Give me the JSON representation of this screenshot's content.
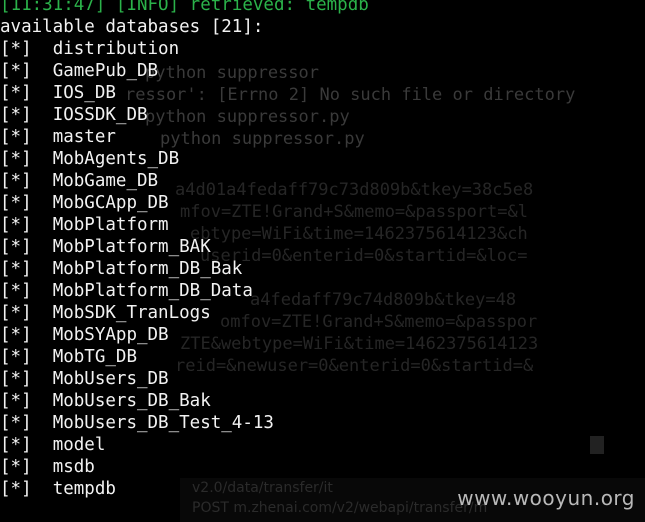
{
  "terminal": {
    "header": {
      "timestamp": "[11:31:47]",
      "level": "[INFO]",
      "message": "retrieved: tempdb"
    },
    "title": "available databases [21]:",
    "marker": "[*]",
    "databases": [
      "distribution",
      "GamePub_DB",
      "IOS_DB",
      "IOSSDK_DB",
      "master",
      "MobAgents_DB",
      "MobGame_DB",
      "MobGCApp_DB",
      "MobPlatform",
      "MobPlatform_BAK",
      "MobPlatform_DB_Bak",
      "MobPlatform_DB_Data",
      "MobSDK_TranLogs",
      "MobSYApp_DB",
      "MobTG_DB",
      "MobUsers_DB",
      "MobUsers_DB_Bak",
      "MobUsers_DB_Test_4-13",
      "model",
      "msdb",
      "tempdb"
    ]
  },
  "background_terminal": {
    "lines": [
      "python suppressor",
      "ressor': [Errno 2] No such file or directory",
      "python suppressor.py",
      "python suppressor.py",
      "a4d01a4fedaff79c73d809b&tkey=38c5e8",
      "mfov=ZTE!Grand+S&memo=&passport=&l",
      "ebtype=WiFi&time=1462375614123&ch",
      "userid=0&enterid=0&startid=&loc=",
      "a4fedaff79c74d809b&tkey=48",
      "omfov=ZTE!Grand+S&memo=&passpor",
      "ZTE&webtype=WiFi&time=1462375614123",
      "reid=&newuser=0&enterid=0&startid=&"
    ],
    "footer_lines": [
      "v2.0/data/transfer/it",
      "POST m.zhenai.com/v2/webapi/transfer/m"
    ]
  },
  "watermark": "www.wooyun.org"
}
